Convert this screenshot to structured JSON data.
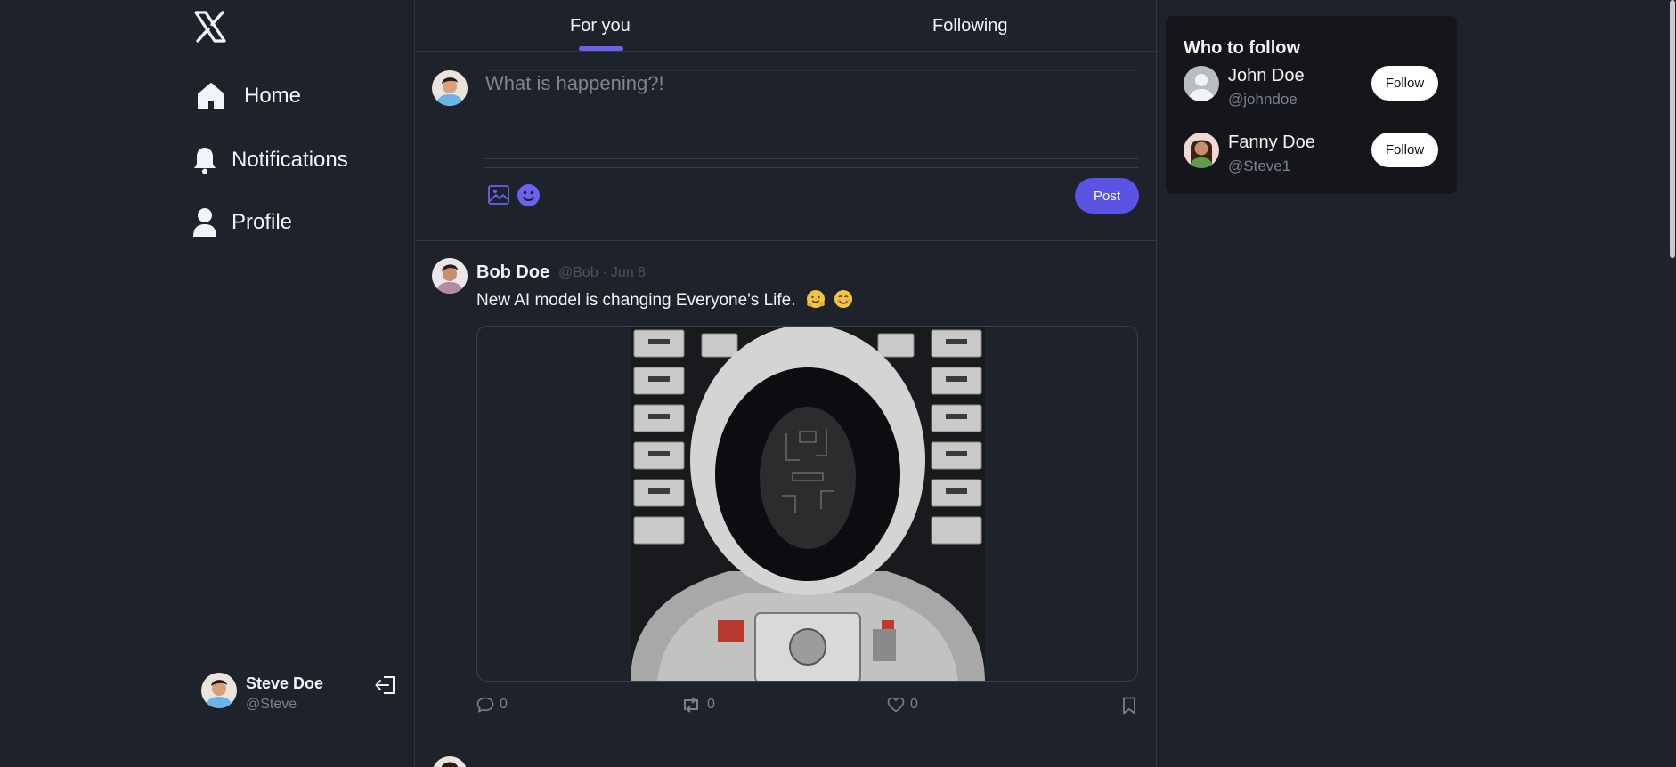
{
  "app": {
    "logo": "x-logo-icon"
  },
  "nav": {
    "items": [
      {
        "label": "Home",
        "icon": "home-icon"
      },
      {
        "label": "Notifications",
        "icon": "bell-icon"
      },
      {
        "label": "Profile",
        "icon": "user-icon"
      }
    ]
  },
  "current_user": {
    "name": "Steve Doe",
    "handle": "@Steve",
    "logout_icon": "logout-icon"
  },
  "tabs": [
    {
      "label": "For you",
      "active": true
    },
    {
      "label": "Following",
      "active": false
    }
  ],
  "composer": {
    "placeholder": "What is happening?!",
    "value": "",
    "post_label": "Post",
    "tools": [
      "image-icon",
      "emoji-icon"
    ]
  },
  "feed": {
    "posts": [
      {
        "author": "Bob Doe",
        "meta": "@Bob · Jun 8",
        "text": "New AI model is changing Everyone's Life.",
        "emojis": [
          "hugging-face-emoji",
          "smiling-face-emoji"
        ],
        "media_description": "astronaut-with-circuit-face-image",
        "replies": "0",
        "reposts": "0",
        "likes": "0"
      }
    ]
  },
  "who_to_follow": {
    "title": "Who to follow",
    "suggestions": [
      {
        "name": "John Doe",
        "handle": "@johndoe",
        "button": "Follow"
      },
      {
        "name": "Fanny Doe",
        "handle": "@Steve1",
        "button": "Follow"
      }
    ]
  },
  "colors": {
    "background": "#1e222b",
    "accent": "#6b62f0",
    "post_button": "#5b53e4",
    "card": "#14161b",
    "muted": "#7a808c"
  }
}
